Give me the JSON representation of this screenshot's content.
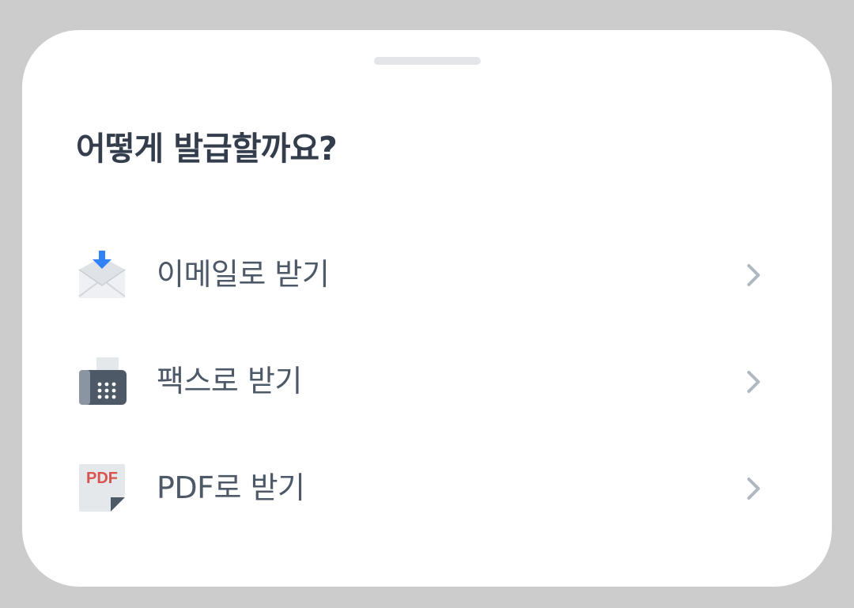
{
  "sheet": {
    "title": "어떻게 발급할까요?"
  },
  "options": [
    {
      "label": "이메일로 받기",
      "icon": "email-download-icon"
    },
    {
      "label": "팩스로 받기",
      "icon": "fax-icon"
    },
    {
      "label": "PDF로 받기",
      "icon": "pdf-file-icon"
    }
  ],
  "colors": {
    "background_dim": "#cccccc",
    "sheet": "#ffffff",
    "title_text": "#333d4b",
    "option_text": "#4e5968",
    "chevron": "#b0b8c1",
    "accent_blue": "#3182f6",
    "pdf_red": "#d9534f"
  }
}
